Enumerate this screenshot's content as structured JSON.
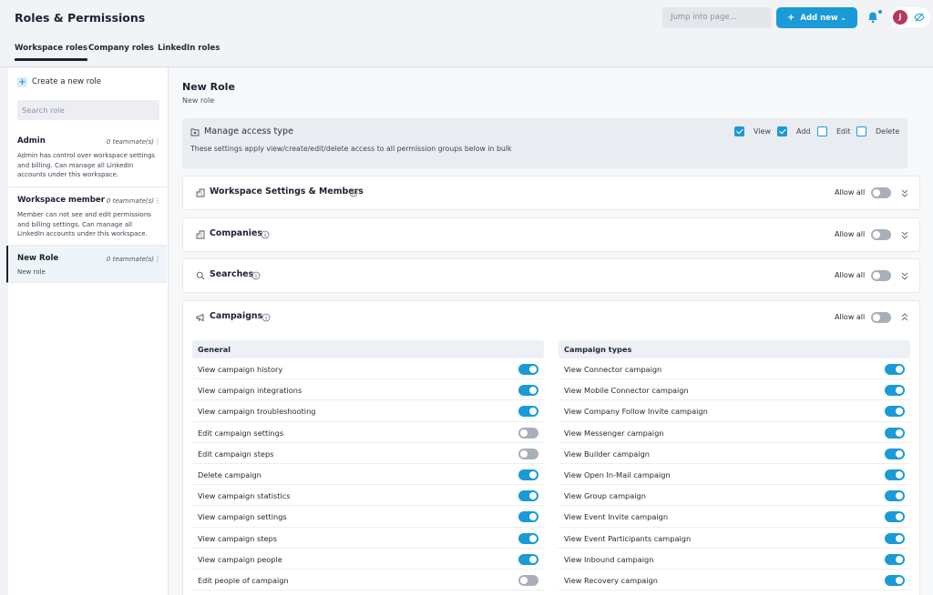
{
  "header": {
    "title": "Roles & Permissions",
    "jump_placeholder": "Jump into page...",
    "add_new_label": "Add new",
    "avatar_initial": "J"
  },
  "tabs": [
    {
      "label": "Workspace roles",
      "active": true
    },
    {
      "label": "Company roles",
      "active": false
    },
    {
      "label": "LinkedIn roles",
      "active": false
    }
  ],
  "sidebar": {
    "create_label": "Create a new role",
    "search_placeholder": "Search role",
    "roles": [
      {
        "name": "Admin",
        "count": "0 teammate(s)",
        "desc": " Admin has control over workspace settings and billing. Can manage all LinkedIn accounts under this workspace."
      },
      {
        "name": "Workspace member",
        "count": "0 teammate(s)",
        "desc": " Member can not see and edit permissions and billing settings. Can manage all LinkedIn accounts under this workspace."
      },
      {
        "name": "New Role",
        "count": "0 teammate(s)",
        "desc": "New role"
      }
    ]
  },
  "main": {
    "title": "New Role",
    "subtitle": "New role",
    "access": {
      "title": "Manage access type",
      "desc": "These settings apply view/create/edit/delete access to all permission groups below in bulk",
      "options": [
        {
          "label": "View",
          "checked": true
        },
        {
          "label": "Add",
          "checked": true
        },
        {
          "label": "Edit",
          "checked": false
        },
        {
          "label": "Delete",
          "checked": false
        }
      ]
    },
    "allow_all_label": "Allow all",
    "sections": [
      {
        "title": "Workspace Settings & Members",
        "icon": "building-icon",
        "expanded": false
      },
      {
        "title": "Companies",
        "icon": "building-icon",
        "expanded": false
      },
      {
        "title": "Searches",
        "icon": "search-icon",
        "expanded": false
      },
      {
        "title": "Campaigns",
        "icon": "megaphone-icon",
        "expanded": true
      }
    ],
    "campaigns": {
      "general_header": "General",
      "types_header": "Campaign types",
      "general": [
        {
          "label": "View campaign history",
          "on": true
        },
        {
          "label": "View campaign integrations",
          "on": true
        },
        {
          "label": "View campaign troubleshooting",
          "on": true
        },
        {
          "label": "Edit campaign settings",
          "on": false
        },
        {
          "label": "Edit campaign steps",
          "on": false
        },
        {
          "label": "Delete campaign",
          "on": true
        },
        {
          "label": "View campaign statistics",
          "on": true
        },
        {
          "label": "View campaign settings",
          "on": true
        },
        {
          "label": "View campaign steps",
          "on": true
        },
        {
          "label": "View campaign people",
          "on": true
        },
        {
          "label": "Edit people of campaign",
          "on": false
        }
      ],
      "types": [
        {
          "label": "View Connector campaign",
          "on": true
        },
        {
          "label": "View Mobile Connector campaign",
          "on": true
        },
        {
          "label": "View Company Follow Invite campaign",
          "on": true
        },
        {
          "label": "View Messenger campaign",
          "on": true
        },
        {
          "label": "View Builder campaign",
          "on": true
        },
        {
          "label": "View Open In-Mail campaign",
          "on": true
        },
        {
          "label": "View Group campaign",
          "on": true
        },
        {
          "label": "View Event Invite campaign",
          "on": true
        },
        {
          "label": "View Event Participants campaign",
          "on": true
        },
        {
          "label": "View Inbound campaign",
          "on": true
        },
        {
          "label": "View Recovery campaign",
          "on": true
        }
      ]
    }
  },
  "colors": {
    "accent": "#1a9ad6",
    "toggle_off": "#a9afb8",
    "avatar": "#b8385a"
  }
}
